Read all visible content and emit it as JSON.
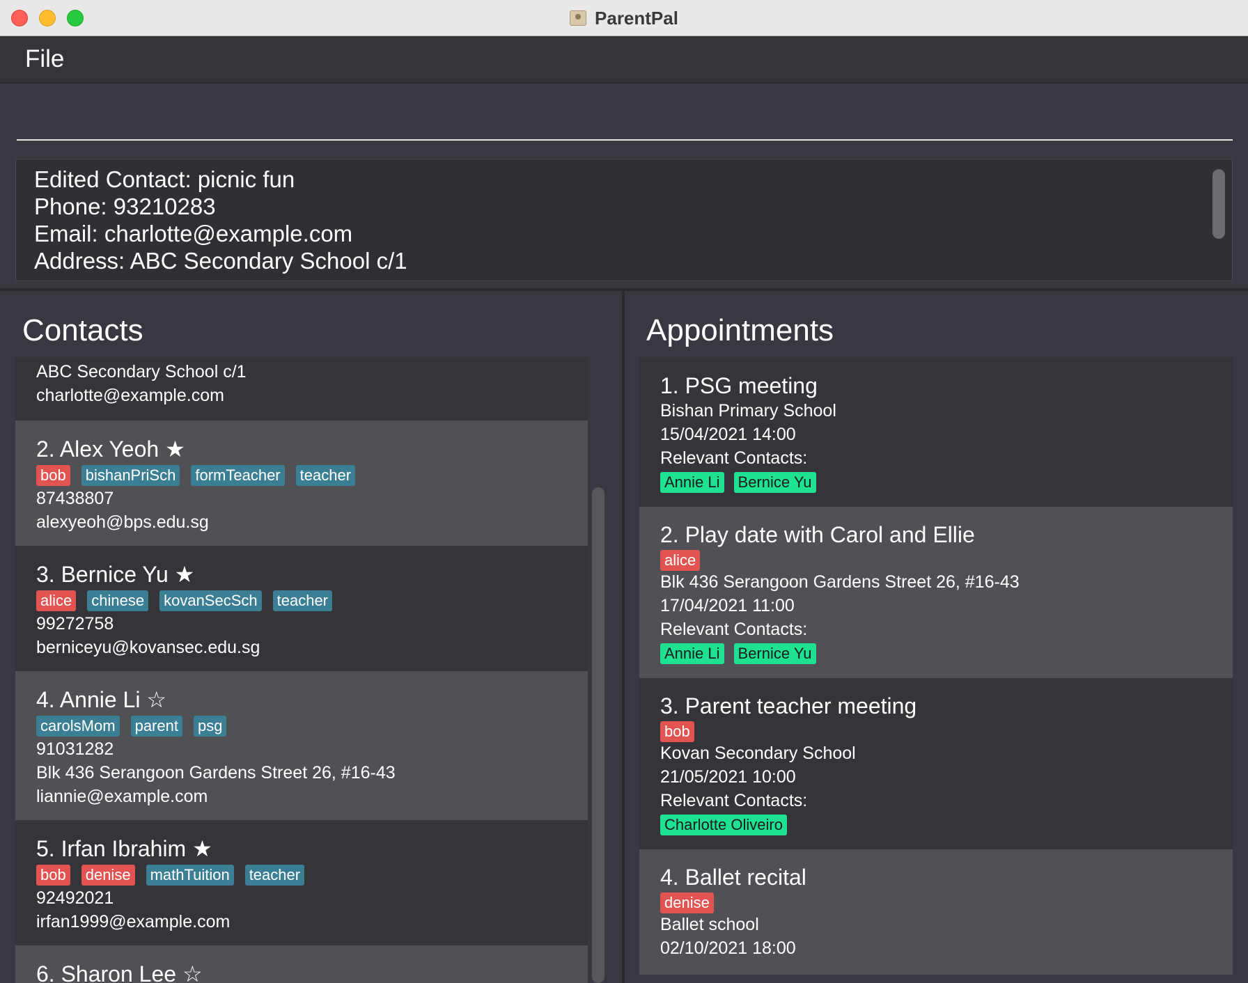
{
  "window": {
    "title": "ParentPal"
  },
  "menu": {
    "file": "File"
  },
  "command": {
    "value": "",
    "placeholder": ""
  },
  "result": {
    "lines": [
      "Edited Contact: picnic fun",
      "Phone: 93210283",
      "Email: charlotte@example.com",
      "Address: ABC Secondary School c/1"
    ]
  },
  "contacts": {
    "title": "Contacts",
    "partial_top": {
      "address": "ABC Secondary School c/1",
      "email": "charlotte@example.com"
    },
    "items": [
      {
        "name": "2.  Alex Yeoh ★",
        "tags": [
          {
            "label": "bob",
            "color": "red"
          },
          {
            "label": "bishanPriSch",
            "color": "blue"
          },
          {
            "label": "formTeacher",
            "color": "blue"
          },
          {
            "label": "teacher",
            "color": "blue"
          }
        ],
        "phone": "87438807",
        "email": "alexyeoh@bps.edu.sg"
      },
      {
        "name": "3.  Bernice Yu ★",
        "tags": [
          {
            "label": "alice",
            "color": "red"
          },
          {
            "label": "chinese",
            "color": "blue"
          },
          {
            "label": "kovanSecSch",
            "color": "blue"
          },
          {
            "label": "teacher",
            "color": "blue"
          }
        ],
        "phone": "99272758",
        "email": "berniceyu@kovansec.edu.sg"
      },
      {
        "name": "4.  Annie Li ☆",
        "tags": [
          {
            "label": "carolsMom",
            "color": "blue"
          },
          {
            "label": "parent",
            "color": "blue"
          },
          {
            "label": "psg",
            "color": "blue"
          }
        ],
        "phone": "91031282",
        "address": "Blk 436 Serangoon Gardens Street 26, #16-43",
        "email": "liannie@example.com"
      },
      {
        "name": "5.  Irfan Ibrahim ★",
        "tags": [
          {
            "label": "bob",
            "color": "red"
          },
          {
            "label": "denise",
            "color": "red"
          },
          {
            "label": "mathTuition",
            "color": "blue"
          },
          {
            "label": "teacher",
            "color": "blue"
          }
        ],
        "phone": "92492021",
        "email": "irfan1999@example.com"
      },
      {
        "name": "6.  Sharon Lee ☆"
      }
    ]
  },
  "appointments": {
    "title": "Appointments",
    "relevant_label": "Relevant Contacts:",
    "items": [
      {
        "title": "1.  PSG meeting",
        "location": "Bishan Primary School",
        "datetime": "15/04/2021 14:00",
        "contacts": [
          "Annie Li",
          "Bernice Yu"
        ]
      },
      {
        "title": "2.  Play date with Carol and Ellie",
        "tag": "alice",
        "location": "Blk 436 Serangoon Gardens Street 26, #16-43",
        "datetime": "17/04/2021 11:00",
        "contacts": [
          "Annie Li",
          "Bernice Yu"
        ]
      },
      {
        "title": "3.  Parent teacher meeting",
        "tag": "bob",
        "location": "Kovan Secondary School",
        "datetime": "21/05/2021 10:00",
        "contacts": [
          "Charlotte Oliveiro"
        ]
      },
      {
        "title": "4.  Ballet recital",
        "tag": "denise",
        "location": "Ballet school",
        "datetime": "02/10/2021 18:00"
      }
    ]
  },
  "colors": {
    "tag_red": "#e15452",
    "tag_blue": "#3c7f95",
    "tag_green": "#1ee292",
    "card_dark": "#343538",
    "card_light": "#4f5155"
  }
}
